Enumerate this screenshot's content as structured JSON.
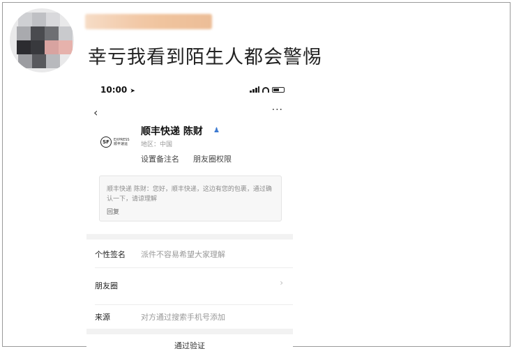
{
  "post": {
    "text": "幸亏我看到陌生人都会警惕"
  },
  "screenshot": {
    "status_bar": {
      "time": "10:00"
    },
    "header": {
      "back_glyph": "‹",
      "more_glyph": "···"
    },
    "logo": {
      "mark": "SF",
      "line1": "EXPRESS",
      "line2": "顺丰速运"
    },
    "profile": {
      "name": "顺丰快递 陈财",
      "region": "地区：中国",
      "set_remark": "设置备注名",
      "moments_permission": "朋友圈权限"
    },
    "greeting": {
      "text": "顺丰快递 陈财：您好，顺丰快递，这边有您的包裹，通过确认一下，请谅理解",
      "reply": "回复"
    },
    "rows": {
      "signature_label": "个性签名",
      "signature_value": "派件不容易希望大家理解",
      "moments_label": "朋友圈",
      "source_label": "来源",
      "source_value": "对方通过搜索手机号添加"
    },
    "verify_button": "通过验证"
  }
}
